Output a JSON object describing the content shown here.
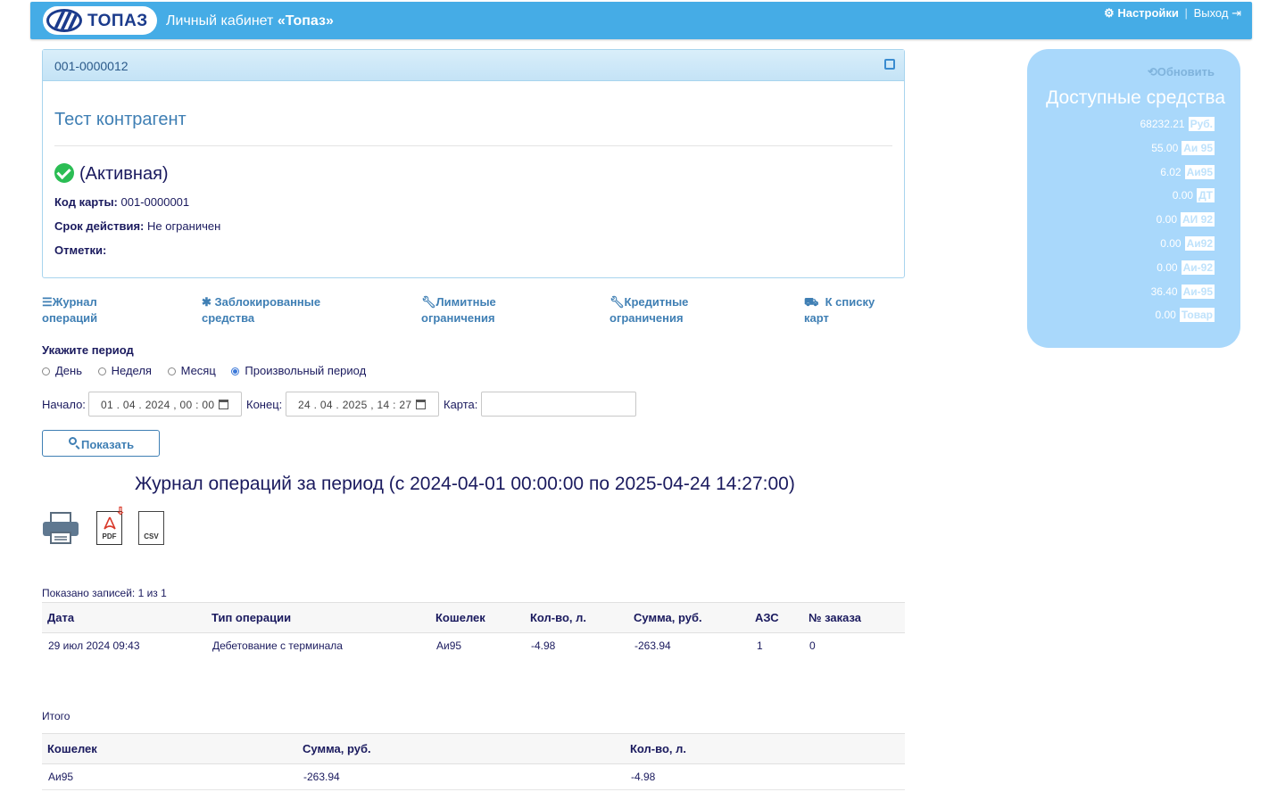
{
  "header": {
    "logo_text": "ТОПАЗ",
    "title_prefix": "Личный кабинет ",
    "title_brand": "«Топаз»",
    "settings_label": "Настройки",
    "separator": "|",
    "logout_label": "Выход",
    "bar_color": "#45ace6"
  },
  "card": {
    "code": "001-0000012",
    "name": "Тест контрагент",
    "status": "(Активная)",
    "card_code_label": "Код карты:",
    "card_code_value": "001-0000001",
    "validity_label": "Срок действия:",
    "validity_value": "Не ограничен",
    "notes_label": "Отметки:",
    "notes_value": ""
  },
  "nav": {
    "journal_l1": "Журнал",
    "journal_l2": "операций",
    "blocked_l1": "Заблокированные",
    "blocked_l2": "средства",
    "limits_l1": "Лимитные",
    "limits_l2": "ограничения",
    "credit_l1": "Кредитные",
    "credit_l2": "ограничения",
    "cards_l1": "К списку",
    "cards_l2": "карт"
  },
  "period": {
    "title": "Укажите период",
    "options": [
      "День",
      "Неделя",
      "Месяц",
      "Произвольный период"
    ],
    "selected": "Произвольный период",
    "start_label": "Начало:",
    "start_value": "01 . 04 . 2024 ,   00 : 00",
    "end_label": "Конец:",
    "end_value": "24 . 04 . 2025 ,   14 : 27",
    "card_label": "Карта:",
    "card_value": "",
    "show_button": "Показать"
  },
  "journal": {
    "title": "Журнал операций за период (с 2024-04-01 00:00:00 по 2025-04-24 14:27:00)",
    "export_pdf": "PDF",
    "export_csv": "CSV",
    "shown_records": "Показано записей: 1 из 1",
    "columns": [
      "Дата",
      "Тип операции",
      "Кошелек",
      "Кол-во, л.",
      "Сумма, руб.",
      "АЗС",
      "№ заказа"
    ],
    "rows": [
      [
        "29 июл 2024 09:43",
        "Дебетование с терминала",
        "Аи95",
        "-4.98",
        "-263.94",
        "1",
        "0"
      ]
    ]
  },
  "totals": {
    "title": "Итого",
    "columns": [
      "Кошелек",
      "Сумма, руб.",
      "Кол-во, л."
    ],
    "rows": [
      [
        "Аи95",
        "-263.94",
        "-4.98"
      ]
    ]
  },
  "balance": {
    "refresh_label": "Обновить",
    "title": "Доступные средства",
    "panel_color": "#a9d8fb",
    "items": [
      {
        "amount": "68232.21",
        "unit": "Руб."
      },
      {
        "amount": "55.00",
        "unit": "Аи 95"
      },
      {
        "amount": "6.02",
        "unit": "Аи95"
      },
      {
        "amount": "0.00",
        "unit": "ДТ"
      },
      {
        "amount": "0.00",
        "unit": "АИ 92"
      },
      {
        "amount": "0.00",
        "unit": "Аи92"
      },
      {
        "amount": "0.00",
        "unit": "Аи-92"
      },
      {
        "amount": "36.40",
        "unit": "Аи-95"
      },
      {
        "amount": "0.00",
        "unit": "Товар"
      }
    ]
  }
}
